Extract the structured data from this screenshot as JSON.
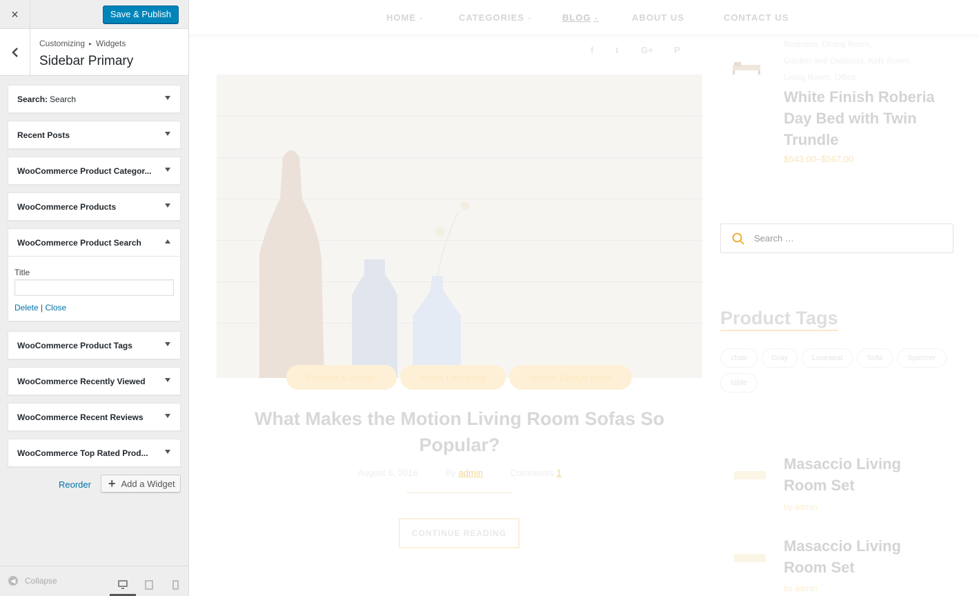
{
  "customizer": {
    "close_icon": "×",
    "publish_label": "Save & Publish",
    "back_icon": "‹",
    "breadcrumb": {
      "part1": "Customizing",
      "separator": "▸",
      "part2": "Widgets"
    },
    "section_title": "Sidebar Primary",
    "widgets": [
      {
        "name": "Search:",
        "subtitle": "Search",
        "expanded": false
      },
      {
        "name": "Recent Posts",
        "expanded": false
      },
      {
        "name": "WooCommerce Product Categor...",
        "expanded": false
      },
      {
        "name": "WooCommerce Products",
        "expanded": false
      },
      {
        "name": "WooCommerce Product Search",
        "expanded": true
      },
      {
        "name": "WooCommerce Product Tags",
        "expanded": false
      },
      {
        "name": "WooCommerce Recently Viewed",
        "expanded": false
      },
      {
        "name": "WooCommerce Recent Reviews",
        "expanded": false
      },
      {
        "name": "WooCommerce Top Rated Prod...",
        "expanded": false
      }
    ],
    "expanded_widget": {
      "field_label": "Title",
      "field_value": "",
      "delete_label": "Delete",
      "link_separator": "|",
      "close_label": "Close"
    },
    "reorder_label": "Reorder",
    "add_widget_label": "Add a Widget",
    "add_widget_icon": "+",
    "footer": {
      "collapse_label": "Collapse",
      "collapse_icon": "◀",
      "active_device": "desktop"
    },
    "colors": {
      "primary_button": "#0085ba",
      "link": "#0073aa",
      "panel_bg": "#eeeeee"
    }
  },
  "preview": {
    "nav": [
      {
        "label": "HOME",
        "has_dropdown": true,
        "chevron": "⌄"
      },
      {
        "label": "CATEGORIES",
        "has_dropdown": true,
        "chevron": "⌄"
      },
      {
        "label": "BLOG",
        "has_dropdown": true,
        "chevron": "⌄",
        "active": true
      },
      {
        "label": "ABOUT US",
        "has_dropdown": false
      },
      {
        "label": "CONTACT US",
        "has_dropdown": false
      }
    ],
    "social_icons": [
      {
        "icon": "facebook-icon",
        "glyph": "f"
      },
      {
        "icon": "twitter-icon",
        "glyph": "t"
      },
      {
        "icon": "google-plus-icon",
        "glyph": "G+"
      },
      {
        "icon": "pinterest-icon",
        "glyph": "P"
      }
    ],
    "post": {
      "categories": [
        "Fashion & Design",
        "Home Designing",
        "Interior Design Ideas"
      ],
      "title_line1": "What Makes the Motion Living Room Sofas So",
      "title_line2": "Popular?",
      "date": "August 6, 2016",
      "by_label": "By",
      "author": "admin",
      "comments_label": "Comments",
      "comments_count": "1",
      "continue_label": "CONTINUE READING"
    },
    "featured_product": {
      "cat_line1": "Bedroom, Dining Room,",
      "cat_line2": "Garden and Outdoors, Kids Room,",
      "cat_line3": "Living Room, Office",
      "name_line1": "White Finish Roberia",
      "name_line2": "Day Bed with Twin",
      "name_line3": "Trundle",
      "price": "$543.00–$567.00"
    },
    "search": {
      "placeholder": "Search …"
    },
    "product_tags": {
      "title": "Product Tags",
      "tags": [
        "chair",
        "Gray",
        "Loveseat",
        "Sofa",
        "Spencer",
        "table"
      ]
    },
    "side_posts": [
      {
        "line1": "Masaccio Living",
        "line2": "Room Set",
        "by": "by admin"
      },
      {
        "line1": "Masaccio Living",
        "line2": "Room Set",
        "by": "by admin"
      }
    ],
    "colors": {
      "accent": "#f5a623",
      "muted_text": "#d4d4d4"
    }
  }
}
